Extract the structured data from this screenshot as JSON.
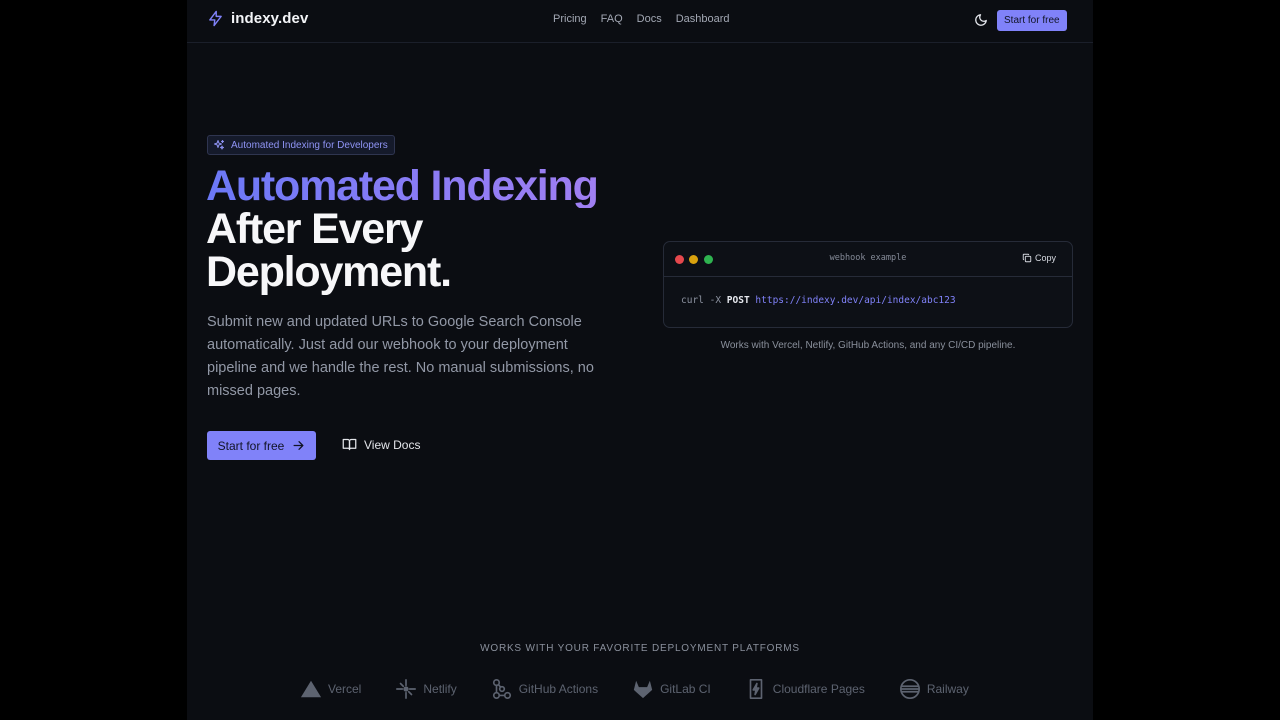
{
  "nav": {
    "brand": "indexy.dev",
    "links": [
      "Pricing",
      "FAQ",
      "Docs",
      "Dashboard"
    ],
    "cta": "Start for free",
    "theme_icon": "moon-icon"
  },
  "hero": {
    "badge": "Automated Indexing for Developers",
    "headline_gradient": "Automated Indexing",
    "headline_line2": "After Every",
    "headline_line3": "Deployment.",
    "subtitle": "Submit new and updated URLs to Google Search Console automatically. Just add our webhook to your deployment pipeline and we handle the rest. No manual submissions, no missed pages.",
    "primary_cta": "Start for free",
    "secondary_cta": "View Docs"
  },
  "terminal": {
    "title": "webhook example",
    "copy_label": "Copy",
    "command": "curl -X",
    "method": "POST",
    "url": "https://indexy.dev/api/index/abc123",
    "caption": "Works with Vercel, Netlify, GitHub Actions, and any CI/CD pipeline."
  },
  "platforms": {
    "heading": "WORKS WITH YOUR FAVORITE DEPLOYMENT PLATFORMS",
    "items": [
      {
        "label": "Vercel",
        "icon": "vercel-icon"
      },
      {
        "label": "Netlify",
        "icon": "netlify-icon"
      },
      {
        "label": "GitHub Actions",
        "icon": "github-actions-icon"
      },
      {
        "label": "GitLab CI",
        "icon": "gitlab-icon"
      },
      {
        "label": "Cloudflare Pages",
        "icon": "cloudflare-icon"
      },
      {
        "label": "Railway",
        "icon": "railway-icon"
      }
    ]
  },
  "colors": {
    "accent": "#8082f9",
    "background": "#0b0d12",
    "outer_background": "#000000"
  }
}
